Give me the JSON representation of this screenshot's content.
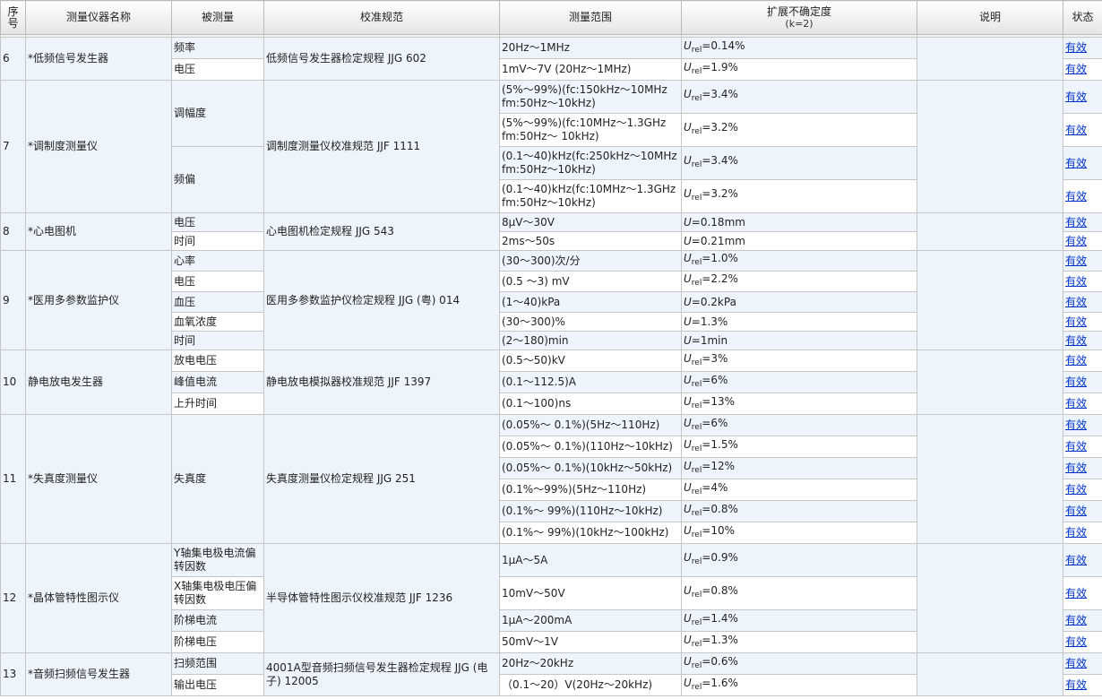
{
  "header": {
    "seq": "序号",
    "name": "测量仪器名称",
    "quantity": "被测量",
    "spec": "校准规范",
    "range": "测量范围",
    "uncertainty": "扩展不确定度",
    "uncertainty_k": "(k=2)",
    "note": "说明",
    "status": "状态"
  },
  "rows": [
    {
      "seq": "6",
      "name": "*低频信号发生器",
      "spec": "低频信号发生器检定规程 JJG 602",
      "items": [
        {
          "q": "频率",
          "range": "20Hz～1MHz",
          "u_sym": "U",
          "u_sub": "rel",
          "u_val": "=0.14%",
          "status": "有效"
        },
        {
          "q": "电压",
          "range": "1mV～7V (20Hz～1MHz)",
          "u_sym": "U",
          "u_sub": "rel",
          "u_val": "=1.9%",
          "status": "有效"
        }
      ]
    },
    {
      "seq": "7",
      "name": "*调制度测量仪",
      "spec": "调制度测量仪校准规范 JJF 1111",
      "groups": [
        {
          "q": "调幅度",
          "items": [
            {
              "range": "(5%～99%)(fc:150kHz～10MHz fm:50Hz～10kHz)",
              "u_sym": "U",
              "u_sub": "rel",
              "u_val": "=3.4%",
              "status": "有效"
            },
            {
              "range": "(5%～99%)(fc:10MHz～1.3GHz fm:50Hz～ 10kHz)",
              "u_sym": "U",
              "u_sub": "rel",
              "u_val": "=3.2%",
              "status": "有效"
            }
          ]
        },
        {
          "q": "频偏",
          "items": [
            {
              "range": "(0.1～40)kHz(fc:250kHz～10MHz fm:50Hz～10kHz)",
              "u_sym": "U",
              "u_sub": "rel",
              "u_val": "=3.4%",
              "status": "有效"
            },
            {
              "range": "(0.1～40)kHz(fc:10MHz～1.3GHz fm:50Hz～10kHz)",
              "u_sym": "U",
              "u_sub": "rel",
              "u_val": "=3.2%",
              "status": "有效"
            }
          ]
        }
      ]
    },
    {
      "seq": "8",
      "name": "*心电图机",
      "spec": "心电图机检定规程 JJG 543",
      "items": [
        {
          "q": "电压",
          "range": "8μV～30V",
          "u_sym": "U",
          "u_sub": "",
          "u_val": "=0.18mm",
          "status": "有效"
        },
        {
          "q": "时间",
          "range": "2ms～50s",
          "u_sym": "U",
          "u_sub": "",
          "u_val": "=0.21mm",
          "status": "有效"
        }
      ]
    },
    {
      "seq": "9",
      "name": "*医用多参数监护仪",
      "spec": "医用多参数监护仪检定规程 JJG (粤) 014",
      "items": [
        {
          "q": "心率",
          "range": "(30～300)次/分",
          "u_sym": "U",
          "u_sub": "rel",
          "u_val": "=1.0%",
          "status": "有效"
        },
        {
          "q": "电压",
          "range": "(0.5 ～3) mV",
          "u_sym": "U",
          "u_sub": "rel",
          "u_val": "=2.2%",
          "status": "有效"
        },
        {
          "q": "血压",
          "range": "(1～40)kPa",
          "u_sym": "U",
          "u_sub": "",
          "u_val": "=0.2kPa",
          "status": "有效"
        },
        {
          "q": "血氧浓度",
          "range": "(30～300)%",
          "u_sym": "U",
          "u_sub": "",
          "u_val": "=1.3%",
          "status": "有效"
        },
        {
          "q": "时间",
          "range": "(2～180)min",
          "u_sym": "U",
          "u_sub": "",
          "u_val": "=1min",
          "status": "有效"
        }
      ]
    },
    {
      "seq": "10",
      "name": "静电放电发生器",
      "spec": "静电放电模拟器校准规范 JJF 1397",
      "items": [
        {
          "q": "放电电压",
          "range": "(0.5～50)kV",
          "u_sym": "U",
          "u_sub": "rel",
          "u_val": "=3%",
          "status": "有效"
        },
        {
          "q": "峰值电流",
          "range": "(0.1～112.5)A",
          "u_sym": "U",
          "u_sub": "rel",
          "u_val": "=6%",
          "status": "有效"
        },
        {
          "q": "上升时间",
          "range": "(0.1～100)ns",
          "u_sym": "U",
          "u_sub": "rel",
          "u_val": "=13%",
          "status": "有效"
        }
      ]
    },
    {
      "seq": "11",
      "name": "*失真度测量仪",
      "q": "失真度",
      "spec": "失真度测量仪检定规程 JJG 251",
      "items": [
        {
          "range": "(0.05%～ 0.1%)(5Hz～110Hz)",
          "u_sym": "U",
          "u_sub": "rel",
          "u_val": "=6%",
          "status": "有效"
        },
        {
          "range": "(0.05%～ 0.1%)(110Hz～10kHz)",
          "u_sym": "U",
          "u_sub": "rel",
          "u_val": "=1.5%",
          "status": "有效"
        },
        {
          "range": "(0.05%～ 0.1%)(10kHz～50kHz)",
          "u_sym": "U",
          "u_sub": "rel",
          "u_val": "=12%",
          "status": "有效"
        },
        {
          "range": "(0.1%～99%)(5Hz～110Hz)",
          "u_sym": "U",
          "u_sub": "rel",
          "u_val": "=4%",
          "status": "有效"
        },
        {
          "range": "(0.1%～ 99%)(110Hz～10kHz)",
          "u_sym": "U",
          "u_sub": "rel",
          "u_val": "=0.8%",
          "status": "有效"
        },
        {
          "range": "(0.1%～ 99%)(10kHz～100kHz)",
          "u_sym": "U",
          "u_sub": "rel",
          "u_val": "=10%",
          "status": "有效"
        }
      ]
    },
    {
      "seq": "12",
      "name": "*晶体管特性图示仪",
      "spec": "半导体管特性图示仪校准规范 JJF 1236",
      "items": [
        {
          "q": "Y轴集电极电流偏转因数",
          "range": "1μA～5A",
          "u_sym": "U",
          "u_sub": "rel",
          "u_val": "=0.9%",
          "status": "有效"
        },
        {
          "q": "X轴集电极电压偏转因数",
          "range": "10mV～50V",
          "u_sym": "U",
          "u_sub": "rel",
          "u_val": "=0.8%",
          "status": "有效"
        },
        {
          "q": "阶梯电流",
          "range": "1μA～200mA",
          "u_sym": "U",
          "u_sub": "rel",
          "u_val": "=1.4%",
          "status": "有效"
        },
        {
          "q": "阶梯电压",
          "range": "50mV～1V",
          "u_sym": "U",
          "u_sub": "rel",
          "u_val": "=1.3%",
          "status": "有效"
        }
      ]
    },
    {
      "seq": "13",
      "name": "*音频扫频信号发生器",
      "spec": "4001A型音频扫频信号发生器检定规程 JJG (电子) 12005",
      "items": [
        {
          "q": "扫频范围",
          "range": "20Hz～20kHz",
          "u_sym": "U",
          "u_sub": "rel",
          "u_val": "=0.6%",
          "status": "有效"
        },
        {
          "q": "输出电压",
          "range": "（0.1～20）V(20Hz～20kHz)",
          "u_sym": "U",
          "u_sub": "rel",
          "u_val": "=1.6%",
          "status": "有效"
        }
      ]
    }
  ]
}
